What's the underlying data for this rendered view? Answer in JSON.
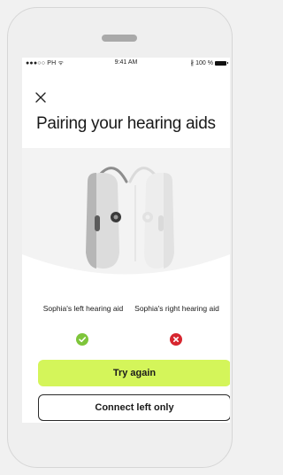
{
  "status_bar": {
    "carrier": "●●●○○ PH ᯤ",
    "time": "9:41 AM",
    "bluetooth": "∦",
    "battery": "100 %"
  },
  "header": {
    "close_icon": "close-icon",
    "title": "Pairing your hearing aids"
  },
  "devices": {
    "left": {
      "label": "Sophia's left hearing aid",
      "status": "paired",
      "status_color": "#7ec53a"
    },
    "right": {
      "label": "Sophia's right hearing aid",
      "status": "failed",
      "status_color": "#d7262f"
    }
  },
  "actions": {
    "try_again": "Try again",
    "connect_left_only": "Connect left only"
  },
  "colors": {
    "accent": "#d4f55a",
    "background": "#ffffff",
    "device_frame": "#efefef"
  }
}
